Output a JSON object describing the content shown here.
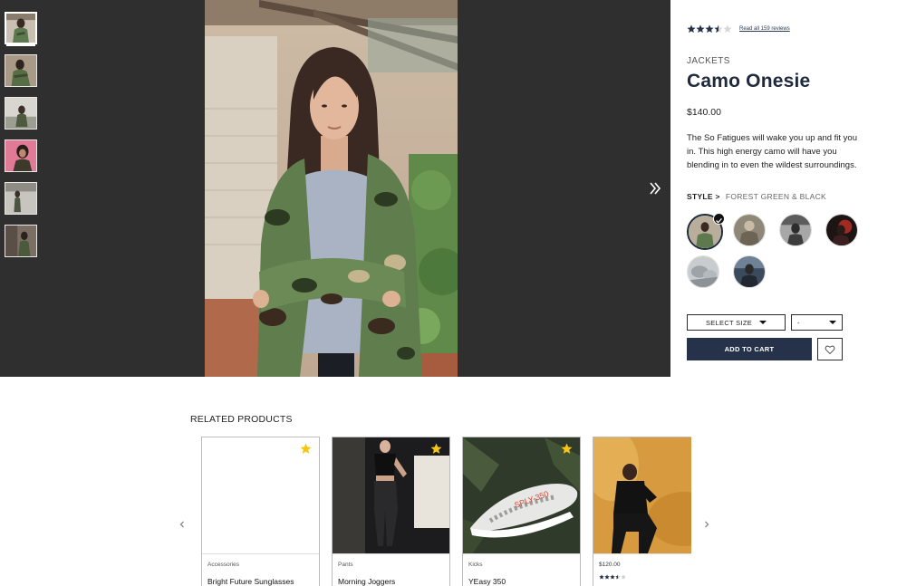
{
  "gallery": {
    "thumbnails": [
      {
        "label": "camo-onesie-front"
      },
      {
        "label": "camo-onesie-angle"
      },
      {
        "label": "camo-onesie-outdoor"
      },
      {
        "label": "camo-onesie-pink"
      },
      {
        "label": "camo-onesie-street"
      },
      {
        "label": "camo-onesie-interior"
      }
    ],
    "active_index": 0
  },
  "product": {
    "rating": 3.5,
    "rating_max": 5,
    "reviews_link": "Read all 159 reviews",
    "category": "JACKETS",
    "title": "Camo Onesie",
    "price": "$140.00",
    "description": "The So Fatigues will wake you up and fit you in. This high energy camo will have you blending in to even the wildest surroundings.",
    "style_label": "STYLE >",
    "style_value": "FOREST GREEN & BLACK",
    "size_select": "SELECT SIZE",
    "qty_select": "-",
    "add_to_cart": "ADD TO CART",
    "colors": {
      "primary": "#25324a",
      "gallery_bg": "#2f2f2f",
      "star": "#f5c518"
    }
  },
  "related": {
    "heading": "RELATED PRODUCTS",
    "items": [
      {
        "category": "Accessories",
        "name": "Bright Future Sunglasses"
      },
      {
        "category": "Pants",
        "name": "Morning Joggers"
      },
      {
        "category": "Kicks",
        "name": "YEasy 350"
      },
      {
        "category": "",
        "name": "",
        "price": "$120.00",
        "rating": 3.5
      }
    ]
  }
}
